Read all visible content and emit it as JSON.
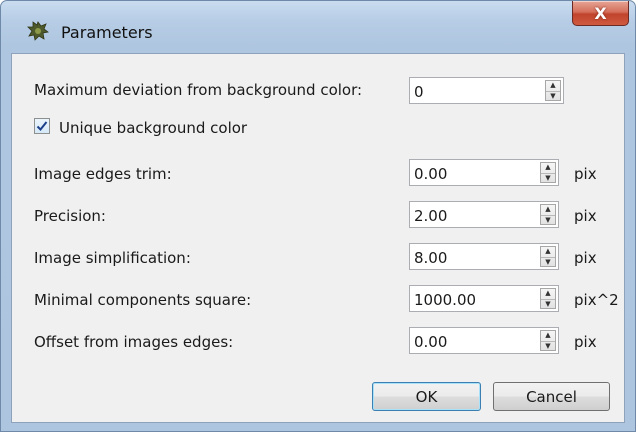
{
  "window": {
    "title": "Parameters",
    "close_label": "X"
  },
  "max_deviation": {
    "label": "Maximum deviation from background color:",
    "value": "0"
  },
  "unique_bg": {
    "label": "Unique background color",
    "checked": true
  },
  "params": [
    {
      "label": "Image edges trim:",
      "value": "0.00",
      "unit": "pix"
    },
    {
      "label": "Precision:",
      "value": "2.00",
      "unit": "pix"
    },
    {
      "label": "Image simplification:",
      "value": "8.00",
      "unit": "pix"
    },
    {
      "label": "Minimal components square:",
      "value": "1000.00",
      "unit": "pix^2"
    },
    {
      "label": "Offset from images edges:",
      "value": "0.00",
      "unit": "pix"
    }
  ],
  "buttons": {
    "ok": "OK",
    "cancel": "Cancel"
  },
  "spin_up": "▲",
  "spin_down": "▼"
}
